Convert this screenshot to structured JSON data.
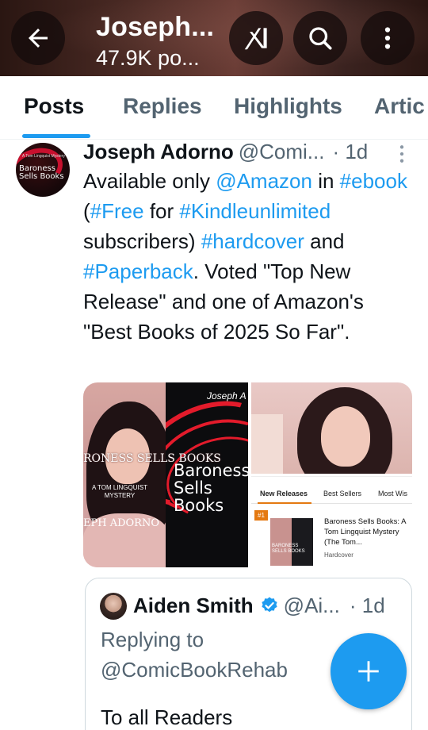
{
  "header": {
    "name": "Joseph...",
    "post_count": "47.9K po..."
  },
  "tabs": [
    {
      "label": "Posts",
      "active": true
    },
    {
      "label": "Replies",
      "active": false
    },
    {
      "label": "Highlights",
      "active": false
    },
    {
      "label": "Artic",
      "active": false
    }
  ],
  "post": {
    "author_name": "Joseph Adorno",
    "author_handle": "@Comi...",
    "time": "· 1d",
    "avatar_text": "Baroness Sells Books",
    "avatar_small_text": "A Tom Lingquist Mystery",
    "text": {
      "t1": "Available only ",
      "amazon": "@Amazon",
      "t2": " in ",
      "ebook": "#ebook",
      "t3": " (",
      "free": "#Free",
      "t4": " for ",
      "kindle": "#Kindleunlimited",
      "t5": " subscribers) ",
      "hardcover": "#hardcover",
      "t6": " and ",
      "paperback": "#Paperback",
      "t7": ". Voted \"Top New Release\" and one of Amazon's \"Best Books of 2025 So Far\"."
    },
    "media": {
      "cover_author_top": "Joseph A",
      "cover_title_left": "RONESS SELLS BOOKS",
      "cover_sub_left": "A TOM LINGQUIST MYSTERY",
      "cover_author_left": "EPH ADORNO",
      "cover_title_right": "Baroness Sells Books",
      "amazon_tabs": [
        "New Releases",
        "Best Sellers",
        "Most Wis"
      ],
      "amazon_rank": "#1",
      "amazon_thumb_text": "BARONESS SELLS BOOKS",
      "amazon_title": "Baroness Sells Books: A Tom Lingquist Mystery (The Tom...",
      "amazon_format": "Hardcover"
    }
  },
  "quote": {
    "name": "Aiden Smith",
    "handle": "@Ai...",
    "time": "· 1d",
    "replying": "Replying to @ComicBookRehab",
    "body": "To all Readers"
  },
  "colors": {
    "accent": "#1d9bf0",
    "text": "#0f1419",
    "muted": "#536471",
    "amazon_orange": "#e47911"
  },
  "icons": {
    "back": "arrow-left-icon",
    "grok": "grok-icon",
    "search": "search-icon",
    "more": "more-vertical-icon",
    "post_more": "more-vertical-icon",
    "verified": "verified-badge-icon",
    "compose": "plus-icon"
  }
}
